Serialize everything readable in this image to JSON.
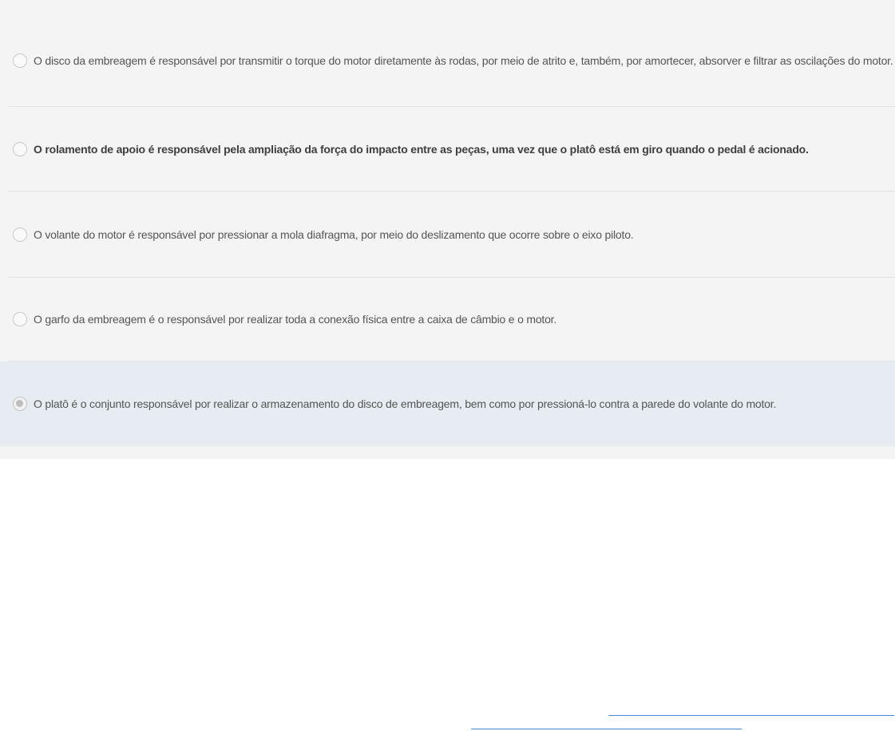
{
  "options": [
    {
      "text": "O disco da embreagem é responsável por transmitir o torque do motor diretamente às rodas, por meio de atrito e, também, por amortecer, absorver e filtrar as oscilações do motor.",
      "bold": false,
      "selected": false
    },
    {
      "text": "O rolamento de apoio é responsável pela ampliação da força do impacto entre as peças, uma vez que o platô está em giro quando o pedal é acionado.",
      "bold": true,
      "selected": false
    },
    {
      "text": "O volante do motor é responsável por pressionar a mola diafragma, por meio do deslizamento que ocorre sobre o eixo piloto.",
      "bold": false,
      "selected": false
    },
    {
      "text": "O garfo da embreagem é o responsável por realizar toda a conexão física entre a caixa de câmbio e o motor.",
      "bold": false,
      "selected": false
    },
    {
      "text": "O platô é o conjunto responsável por realizar o armazenamento do disco de embreagem, bem como por pressioná-lo contra a parede do volante do motor.",
      "bold": false,
      "selected": true
    }
  ],
  "colors": {
    "panel_background": "#f4f4f4",
    "selected_background": "#e7ecf2",
    "divider": "#e2e2e2",
    "text": "#555555",
    "link_underline": "#4a86d6"
  }
}
